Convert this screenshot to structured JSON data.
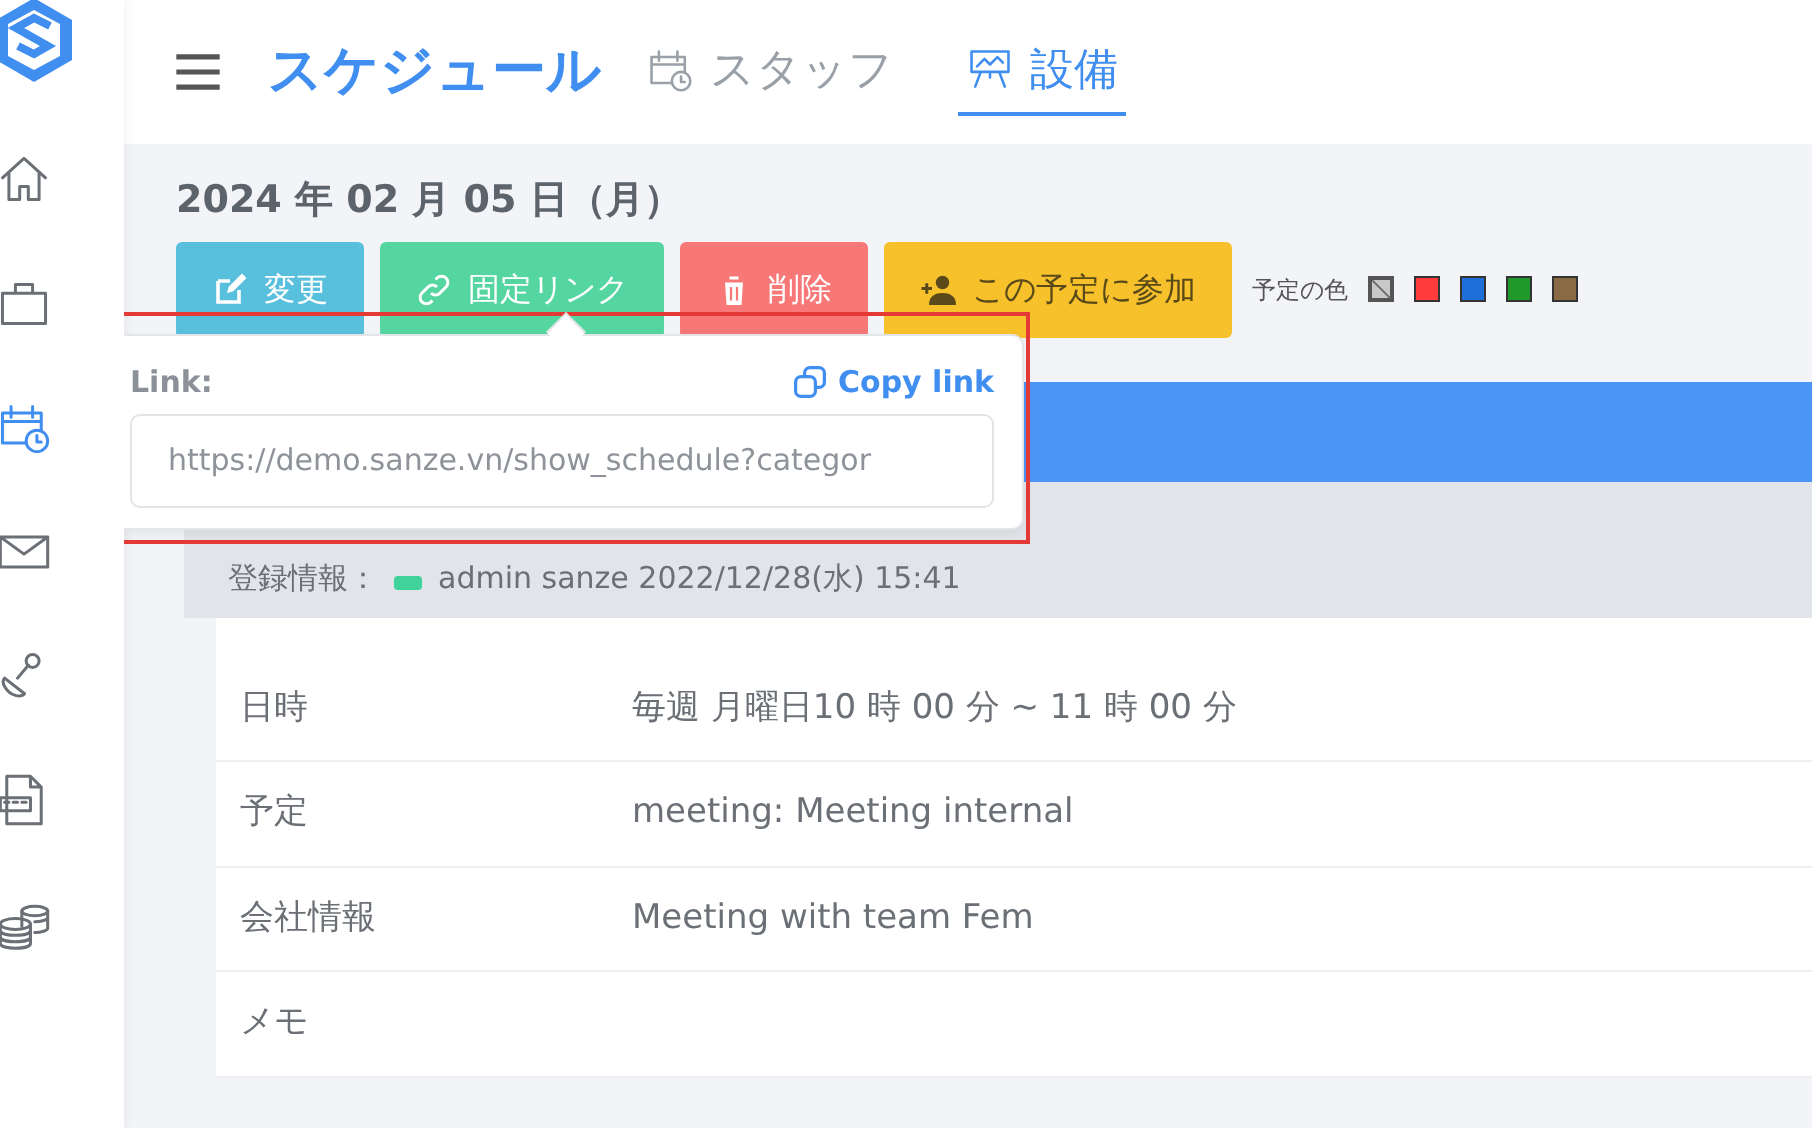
{
  "sidebar": {
    "items": [
      {
        "selected": false
      },
      {
        "selected": false
      },
      {
        "selected": true
      },
      {
        "selected": false
      },
      {
        "selected": false
      },
      {
        "selected": false
      },
      {
        "selected": false
      }
    ]
  },
  "header": {
    "title": "スケジュール",
    "tabs": [
      {
        "label": "スタッフ",
        "selected": false
      },
      {
        "label": "設備",
        "selected": true
      }
    ]
  },
  "date": "2024 年 02 月 05 日（月）",
  "actions": [
    {
      "label": "変更",
      "kind": "edit"
    },
    {
      "label": "固定リンク",
      "kind": "link"
    },
    {
      "label": "削除",
      "kind": "delete"
    },
    {
      "label": "この予定に参加",
      "kind": "join"
    }
  ],
  "color_picker": {
    "label": "予定の色",
    "swatches": [
      {
        "kind": "none",
        "color": "#c8c8c8"
      },
      {
        "kind": "color",
        "color": "#ff3b3b"
      },
      {
        "kind": "color",
        "color": "#1e6fd9"
      },
      {
        "kind": "color",
        "color": "#1f9a2a"
      },
      {
        "kind": "color",
        "color": "#8a6a45"
      }
    ]
  },
  "popover": {
    "label": "Link:",
    "copy": "Copy link",
    "value": "https://demo.sanze.vn/show_schedule?categor"
  },
  "registration": {
    "label": "登録情報：",
    "value": "admin sanze 2022/12/28(水) 15:41"
  },
  "details": [
    {
      "label": "日時",
      "value": "毎週 月曜日10 時 00 分 ~ 11 時 00 分"
    },
    {
      "label": "予定",
      "value": "meeting: Meeting internal"
    },
    {
      "label": "会社情報",
      "value": "Meeting with team Fem"
    },
    {
      "label": "メモ"
    }
  ]
}
